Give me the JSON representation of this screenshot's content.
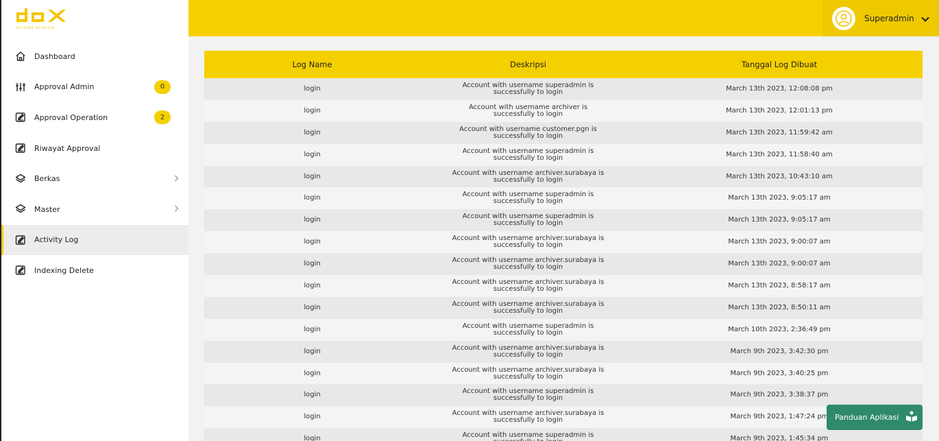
{
  "app": {
    "logo_text": "dox",
    "logo_tagline": "EXTREME MAINTAIN"
  },
  "header": {
    "user_name": "Superadmin"
  },
  "sidebar": {
    "items": [
      {
        "label": "Dashboard",
        "icon": "home-icon"
      },
      {
        "label": "Approval Admin",
        "icon": "sliders-icon",
        "badge": "0"
      },
      {
        "label": "Approval Operation",
        "icon": "edit-icon",
        "badge": "2"
      },
      {
        "label": "Riwayat Approval",
        "icon": "edit-icon"
      },
      {
        "label": "Berkas",
        "icon": "layers-icon",
        "chevron": true
      },
      {
        "label": "Master",
        "icon": "layers-icon",
        "chevron": true
      },
      {
        "label": "Activity Log",
        "icon": "edit-icon",
        "active": true
      },
      {
        "label": "Indexing Delete",
        "icon": "edit-icon"
      }
    ]
  },
  "table": {
    "headers": [
      "Log Name",
      "Deskripsi",
      "Tanggal Log Dibuat"
    ],
    "rows": [
      {
        "name": "login",
        "desc": "Account with username superadmin is successfully to login",
        "date": "March 13th 2023, 12:08:08 pm"
      },
      {
        "name": "login",
        "desc": "Account with username archiver is successfully to login",
        "date": "March 13th 2023, 12:01:13 pm"
      },
      {
        "name": "login",
        "desc": "Account with username customer.pgn is successfully to login",
        "date": "March 13th 2023, 11:59:42 am"
      },
      {
        "name": "login",
        "desc": "Account with username superadmin is successfully to login",
        "date": "March 13th 2023, 11:58:40 am"
      },
      {
        "name": "login",
        "desc": "Account with username archiver.surabaya is successfully to login",
        "date": "March 13th 2023, 10:43:10 am"
      },
      {
        "name": "login",
        "desc": "Account with username superadmin is successfully to login",
        "date": "March 13th 2023, 9:05:17 am"
      },
      {
        "name": "login",
        "desc": "Account with username superadmin is successfully to login",
        "date": "March 13th 2023, 9:05:17 am"
      },
      {
        "name": "login",
        "desc": "Account with username archiver.surabaya is successfully to login",
        "date": "March 13th 2023, 9:00:07 am"
      },
      {
        "name": "login",
        "desc": "Account with username archiver.surabaya is successfully to login",
        "date": "March 13th 2023, 9:00:07 am"
      },
      {
        "name": "login",
        "desc": "Account with username archiver.surabaya is successfully to login",
        "date": "March 13th 2023, 8:58:17 am"
      },
      {
        "name": "login",
        "desc": "Account with username archiver.surabaya is successfully to login",
        "date": "March 13th 2023, 8:50:11 am"
      },
      {
        "name": "login",
        "desc": "Account with username superadmin is successfully to login",
        "date": "March 10th 2023, 2:36:49 pm"
      },
      {
        "name": "login",
        "desc": "Account with username archiver.surabaya is successfully to login",
        "date": "March 9th 2023, 3:42:30 pm"
      },
      {
        "name": "login",
        "desc": "Account with username archiver.surabaya is successfully to login",
        "date": "March 9th 2023, 3:40:25 pm"
      },
      {
        "name": "login",
        "desc": "Account with username superadmin is successfully to login",
        "date": "March 9th 2023, 3:38:37 pm"
      },
      {
        "name": "login",
        "desc": "Account with username archiver.surabaya is successfully to login",
        "date": "March 9th 2023, 1:47:24 pm"
      },
      {
        "name": "login",
        "desc": "Account with username superadmin is successfully to login",
        "date": "March 9th 2023, 1:45:34 pm"
      }
    ]
  },
  "help_button": {
    "label": "Panduan Aplikasi",
    "icon": "book-reader-icon"
  },
  "colors": {
    "accent": "#f5d000",
    "help_button": "#2f8a6d"
  }
}
